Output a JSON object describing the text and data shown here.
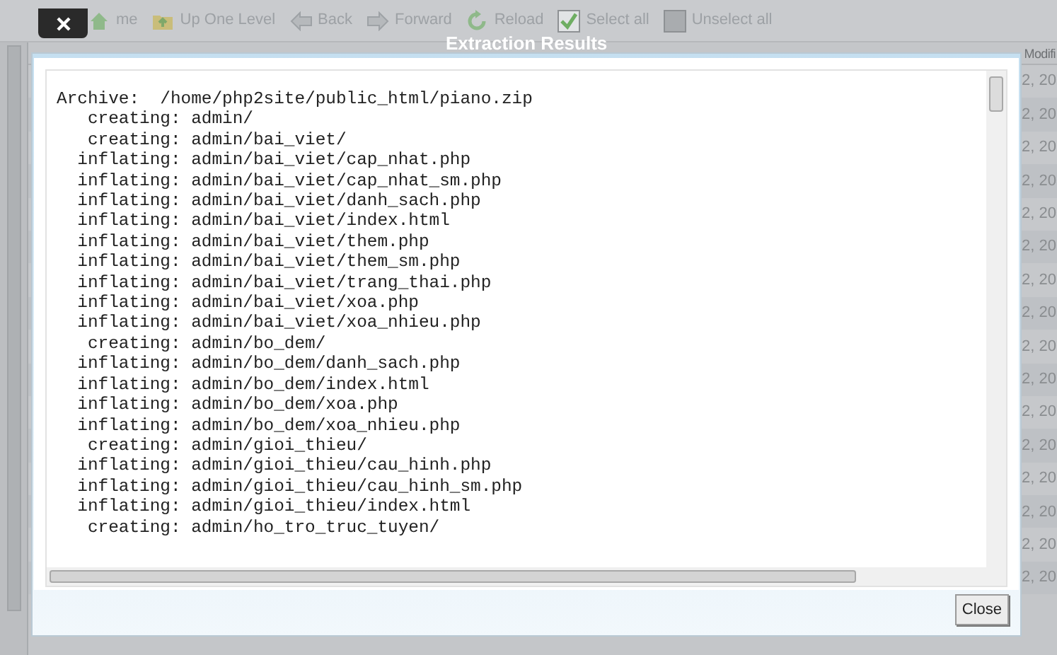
{
  "toolbar": [
    {
      "kind": "home",
      "label": "me"
    },
    {
      "kind": "up",
      "label": "Up One Level"
    },
    {
      "kind": "back",
      "label": "Back"
    },
    {
      "kind": "forward",
      "label": "Forward"
    },
    {
      "kind": "reload",
      "label": "Reload"
    },
    {
      "kind": "check",
      "label": "Select all",
      "checked": true
    },
    {
      "kind": "check",
      "label": "Unselect all",
      "checked": false
    }
  ],
  "table": {
    "columns": [
      "Modifi"
    ],
    "rows": [
      "2, 20",
      "2, 20",
      "2, 20",
      "2, 20",
      "2, 20",
      "2, 20",
      "2, 20",
      "2, 20",
      "2, 20",
      "2, 20",
      "2, 20",
      "2, 20",
      "2, 20",
      "2, 20",
      "2, 20",
      "2, 20"
    ]
  },
  "dialog": {
    "title": "Extraction Results",
    "close_button": "Close",
    "output": [
      "Archive:  /home/php2site/public_html/piano.zip",
      "   creating: admin/",
      "   creating: admin/bai_viet/",
      "  inflating: admin/bai_viet/cap_nhat.php",
      "  inflating: admin/bai_viet/cap_nhat_sm.php",
      "  inflating: admin/bai_viet/danh_sach.php",
      "  inflating: admin/bai_viet/index.html",
      "  inflating: admin/bai_viet/them.php",
      "  inflating: admin/bai_viet/them_sm.php",
      "  inflating: admin/bai_viet/trang_thai.php",
      "  inflating: admin/bai_viet/xoa.php",
      "  inflating: admin/bai_viet/xoa_nhieu.php",
      "   creating: admin/bo_dem/",
      "  inflating: admin/bo_dem/danh_sach.php",
      "  inflating: admin/bo_dem/index.html",
      "  inflating: admin/bo_dem/xoa.php",
      "  inflating: admin/bo_dem/xoa_nhieu.php",
      "   creating: admin/gioi_thieu/",
      "  inflating: admin/gioi_thieu/cau_hinh.php",
      "  inflating: admin/gioi_thieu/cau_hinh_sm.php",
      "  inflating: admin/gioi_thieu/index.html",
      "   creating: admin/ho_tro_truc_tuyen/"
    ]
  }
}
